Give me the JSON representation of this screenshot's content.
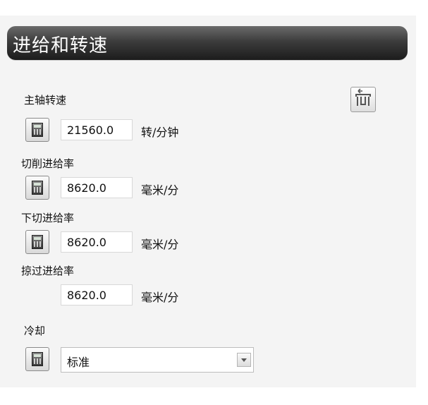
{
  "panel": {
    "title": "进给和转速"
  },
  "spindle_speed": {
    "label": "主轴转速",
    "value": "21560.0",
    "unit": "转/分钟"
  },
  "cutting_feed": {
    "label": "切削进给率",
    "value": "8620.0",
    "unit": "毫米/分"
  },
  "plunge_feed": {
    "label": "下切进给率",
    "value": "8620.0",
    "unit": "毫米/分"
  },
  "skim_feed": {
    "label": "掠过进给率",
    "value": "8620.0",
    "unit": "毫米/分"
  },
  "coolant": {
    "label": "冷却",
    "selected": "标准"
  },
  "icons": {
    "calculator": "calculator-icon",
    "load_from_tool": "load-from-tool-icon",
    "dropdown": "chevron-down-icon"
  }
}
